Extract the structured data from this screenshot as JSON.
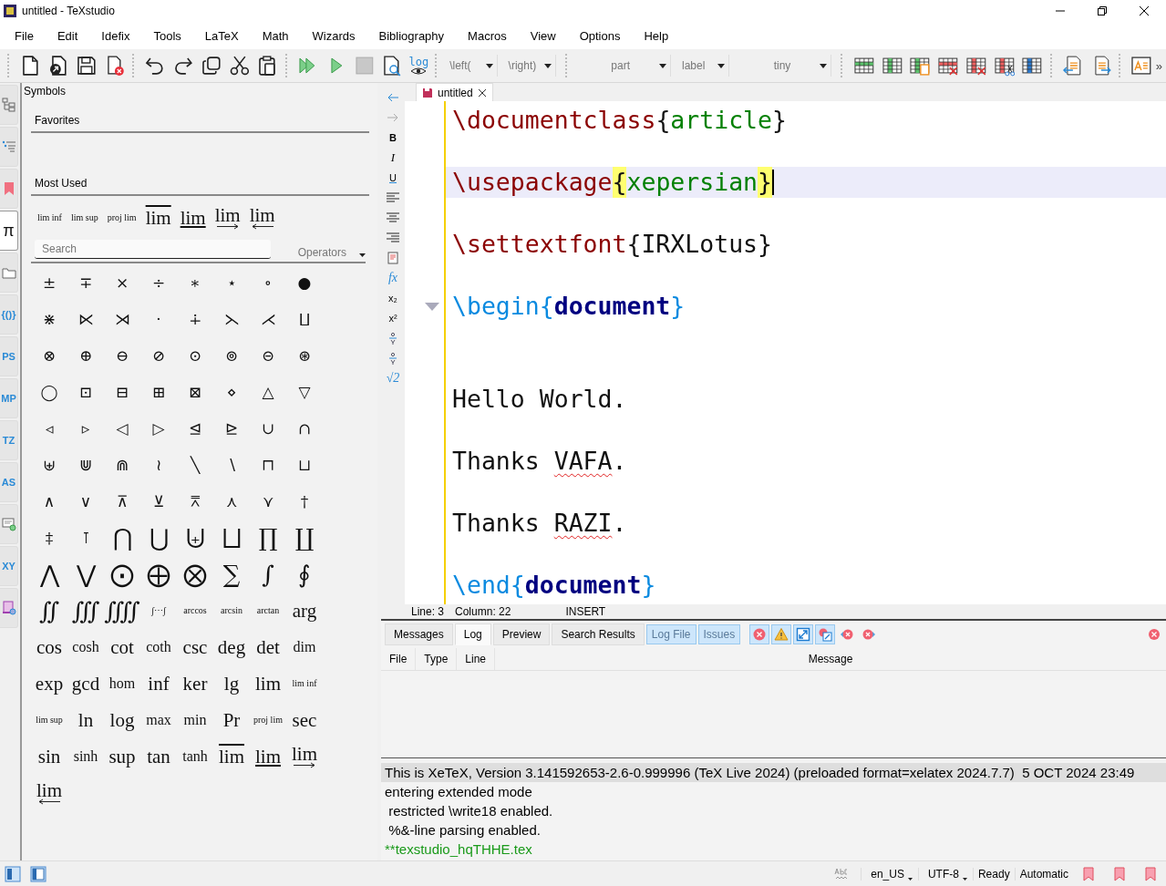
{
  "window": {
    "title": "untitled - TeXstudio"
  },
  "menu": [
    "File",
    "Edit",
    "Idefix",
    "Tools",
    "LaTeX",
    "Math",
    "Wizards",
    "Bibliography",
    "Macros",
    "View",
    "Options",
    "Help"
  ],
  "toolbar": [
    [
      {
        "kind": "new"
      },
      {
        "kind": "open"
      },
      {
        "kind": "save"
      },
      {
        "kind": "close"
      }
    ],
    [
      {
        "kind": "undo"
      },
      {
        "kind": "redo"
      },
      {
        "kind": "copy"
      },
      {
        "kind": "cut"
      },
      {
        "kind": "paste"
      }
    ],
    [
      {
        "kind": "build-view"
      },
      {
        "kind": "compile"
      },
      {
        "kind": "stop"
      },
      {
        "kind": "view"
      },
      {
        "kind": "log",
        "label": "log"
      }
    ],
    [
      {
        "kind": "combo",
        "value": "\\left("
      },
      {
        "kind": "combo",
        "value": "\\right)"
      }
    ],
    [
      {
        "kind": "wide-combo",
        "value": "part"
      },
      {
        "kind": "combo",
        "value": "label"
      },
      {
        "kind": "wide-combo",
        "value": "tiny"
      }
    ],
    [
      {
        "kind": "table-row"
      },
      {
        "kind": "table-column"
      },
      {
        "kind": "table-paste"
      },
      {
        "kind": "table-remove-row"
      },
      {
        "kind": "table-remove-column"
      },
      {
        "kind": "table-cut"
      },
      {
        "kind": "table-align"
      }
    ],
    [
      {
        "kind": "unindent"
      },
      {
        "kind": "indent"
      }
    ],
    [
      {
        "kind": "text-box"
      }
    ]
  ],
  "toolbar_overflow": "»",
  "side_tabs": [
    {
      "kind": "structure",
      "selected": false
    },
    {
      "kind": "todo",
      "selected": false
    },
    {
      "kind": "bookmark",
      "selected": false
    },
    {
      "kind": "text",
      "label": "π",
      "selected": true
    },
    {
      "kind": "files",
      "selected": false
    },
    {
      "kind": "text",
      "label": "{()}",
      "selected": false
    },
    {
      "kind": "text",
      "label": "PS",
      "selected": false
    },
    {
      "kind": "text",
      "label": "MP",
      "selected": false
    },
    {
      "kind": "text",
      "label": "TZ",
      "selected": false
    },
    {
      "kind": "text",
      "label": "AS",
      "selected": false
    },
    {
      "kind": "screen",
      "selected": false
    },
    {
      "kind": "text",
      "label": "XY",
      "selected": false
    },
    {
      "kind": "script",
      "selected": false
    }
  ],
  "symbols_panel": {
    "title": "Symbols",
    "favorites_heading": "Favorites",
    "most_used_heading": "Most Used",
    "most_used": [
      {
        "text": "lim inf",
        "kind": "tiny"
      },
      {
        "text": "lim sup",
        "kind": "tiny"
      },
      {
        "text": "proj lim",
        "kind": "tiny"
      },
      {
        "text": "lim",
        "kind": "overline"
      },
      {
        "text": "lim",
        "kind": "underline"
      },
      {
        "text": "lim",
        "kind": "right-arrow"
      },
      {
        "text": "lim",
        "kind": "left-arrow"
      }
    ],
    "search": {
      "placeholder": "Search"
    },
    "category": "Operators",
    "symbols": [
      {
        "text": "±",
        "kind": "glyph"
      },
      {
        "text": "∓",
        "kind": "glyph"
      },
      {
        "text": "×",
        "kind": "glyph"
      },
      {
        "text": "÷",
        "kind": "glyph"
      },
      {
        "text": "∗",
        "kind": "glyph"
      },
      {
        "text": "⋆",
        "kind": "glyph"
      },
      {
        "text": "∘",
        "kind": "glyph"
      },
      {
        "text": "●",
        "kind": "glyph"
      },
      {
        "text": "⋇",
        "kind": "glyph"
      },
      {
        "text": "⋉",
        "kind": "glyph"
      },
      {
        "text": "⋊",
        "kind": "glyph"
      },
      {
        "text": "·",
        "kind": "glyph"
      },
      {
        "text": "∔",
        "kind": "glyph"
      },
      {
        "text": "⋋",
        "kind": "glyph"
      },
      {
        "text": "⋌",
        "kind": "glyph"
      },
      {
        "text": "⨿",
        "kind": "glyph"
      },
      {
        "text": "⊗",
        "kind": "glyph"
      },
      {
        "text": "⊕",
        "kind": "glyph"
      },
      {
        "text": "⊖",
        "kind": "glyph"
      },
      {
        "text": "⊘",
        "kind": "glyph"
      },
      {
        "text": "⊙",
        "kind": "glyph"
      },
      {
        "text": "⊚",
        "kind": "glyph"
      },
      {
        "text": "⊝",
        "kind": "glyph"
      },
      {
        "text": "⊛",
        "kind": "glyph"
      },
      {
        "text": "◯",
        "kind": "glyph"
      },
      {
        "text": "⊡",
        "kind": "glyph"
      },
      {
        "text": "⊟",
        "kind": "glyph"
      },
      {
        "text": "⊞",
        "kind": "glyph"
      },
      {
        "text": "⊠",
        "kind": "glyph"
      },
      {
        "text": "⋄",
        "kind": "glyph"
      },
      {
        "text": "△",
        "kind": "glyph"
      },
      {
        "text": "▽",
        "kind": "glyph"
      },
      {
        "text": "◃",
        "kind": "glyph"
      },
      {
        "text": "▹",
        "kind": "glyph"
      },
      {
        "text": "◁",
        "kind": "glyph"
      },
      {
        "text": "▷",
        "kind": "glyph"
      },
      {
        "text": "⊴",
        "kind": "glyph"
      },
      {
        "text": "⊵",
        "kind": "glyph"
      },
      {
        "text": "∪",
        "kind": "glyph"
      },
      {
        "text": "∩",
        "kind": "glyph"
      },
      {
        "text": "⊎",
        "kind": "glyph"
      },
      {
        "text": "⋓",
        "kind": "glyph"
      },
      {
        "text": "⋒",
        "kind": "glyph"
      },
      {
        "text": "≀",
        "kind": "glyph"
      },
      {
        "text": "╲",
        "kind": "glyph"
      },
      {
        "text": "∖",
        "kind": "glyph"
      },
      {
        "text": "⊓",
        "kind": "glyph"
      },
      {
        "text": "⊔",
        "kind": "glyph"
      },
      {
        "text": "∧",
        "kind": "glyph"
      },
      {
        "text": "∨",
        "kind": "glyph"
      },
      {
        "text": "⊼",
        "kind": "glyph"
      },
      {
        "text": "⊻",
        "kind": "glyph"
      },
      {
        "text": "⩞",
        "kind": "glyph"
      },
      {
        "text": "⋏",
        "kind": "glyph"
      },
      {
        "text": "⋎",
        "kind": "glyph"
      },
      {
        "text": "†",
        "kind": "glyph"
      },
      {
        "text": "‡",
        "kind": "glyph"
      },
      {
        "text": "⊺",
        "kind": "glyph"
      },
      {
        "text": "⋂",
        "kind": "big"
      },
      {
        "text": "⋃",
        "kind": "big"
      },
      {
        "text": "⨄",
        "kind": "big"
      },
      {
        "text": "⨆",
        "kind": "big"
      },
      {
        "text": "∏",
        "kind": "big"
      },
      {
        "text": "∐",
        "kind": "big"
      },
      {
        "text": "⋀",
        "kind": "big"
      },
      {
        "text": "⋁",
        "kind": "big"
      },
      {
        "text": "⨀",
        "kind": "big"
      },
      {
        "text": "⨁",
        "kind": "big"
      },
      {
        "text": "⨂",
        "kind": "big"
      },
      {
        "text": "∑",
        "kind": "big"
      },
      {
        "text": "∫",
        "kind": "big"
      },
      {
        "text": "∮",
        "kind": "big"
      },
      {
        "text": "∬",
        "kind": "big"
      },
      {
        "text": "∭",
        "kind": "big"
      },
      {
        "text": "⨌",
        "kind": "big"
      },
      {
        "text": "∫⋯∫",
        "kind": "tiny"
      },
      {
        "text": "arccos",
        "kind": "tiny"
      },
      {
        "text": "arcsin",
        "kind": "tiny"
      },
      {
        "text": "arctan",
        "kind": "tiny"
      },
      {
        "text": "arg",
        "kind": "word"
      },
      {
        "text": "cos",
        "kind": "word"
      },
      {
        "text": "cosh",
        "kind": "small"
      },
      {
        "text": "cot",
        "kind": "word"
      },
      {
        "text": "coth",
        "kind": "small"
      },
      {
        "text": "csc",
        "kind": "word"
      },
      {
        "text": "deg",
        "kind": "word"
      },
      {
        "text": "det",
        "kind": "word"
      },
      {
        "text": "dim",
        "kind": "small"
      },
      {
        "text": "exp",
        "kind": "word"
      },
      {
        "text": "gcd",
        "kind": "word"
      },
      {
        "text": "hom",
        "kind": "small"
      },
      {
        "text": "inf",
        "kind": "word"
      },
      {
        "text": "ker",
        "kind": "word"
      },
      {
        "text": "lg",
        "kind": "word"
      },
      {
        "text": "lim",
        "kind": "word"
      },
      {
        "text": "lim inf",
        "kind": "tiny"
      },
      {
        "text": "lim sup",
        "kind": "tiny"
      },
      {
        "text": "ln",
        "kind": "word"
      },
      {
        "text": "log",
        "kind": "word"
      },
      {
        "text": "max",
        "kind": "small"
      },
      {
        "text": "min",
        "kind": "small"
      },
      {
        "text": "Pr",
        "kind": "word"
      },
      {
        "text": "proj lim",
        "kind": "tiny"
      },
      {
        "text": "sec",
        "kind": "word"
      },
      {
        "text": "sin",
        "kind": "word"
      },
      {
        "text": "sinh",
        "kind": "small"
      },
      {
        "text": "sup",
        "kind": "word"
      },
      {
        "text": "tan",
        "kind": "word"
      },
      {
        "text": "tanh",
        "kind": "small"
      },
      {
        "text": "lim",
        "kind": "overline"
      },
      {
        "text": "lim",
        "kind": "underline"
      },
      {
        "text": "lim",
        "kind": "right-arrow"
      },
      {
        "text": "lim",
        "kind": "left-arrow"
      }
    ]
  },
  "format_bar": [
    {
      "kind": "back"
    },
    {
      "kind": "forward"
    },
    {
      "kind": "bold",
      "label": "B"
    },
    {
      "kind": "italic",
      "label": "I"
    },
    {
      "kind": "underline",
      "label": "U"
    },
    {
      "kind": "align-left"
    },
    {
      "kind": "align-center"
    },
    {
      "kind": "align-right"
    },
    {
      "kind": "document"
    },
    {
      "kind": "function",
      "label": "fx"
    },
    {
      "kind": "subscript",
      "label": "x₂"
    },
    {
      "kind": "superscript",
      "label": "x²"
    },
    {
      "kind": "fraction"
    },
    {
      "kind": "fraction"
    },
    {
      "kind": "root",
      "label": "√2"
    }
  ],
  "editor": {
    "tab": {
      "title": "untitled"
    },
    "lines": [
      {
        "current": false,
        "foldable": false,
        "segments": [
          {
            "text": "\\documentclass",
            "kind": "command"
          },
          {
            "text": "{",
            "kind": "brace"
          },
          {
            "text": "article",
            "kind": "arg"
          },
          {
            "text": "}",
            "kind": "brace"
          }
        ]
      },
      {
        "current": false,
        "foldable": false
      },
      {
        "current": true,
        "foldable": false,
        "segments": [
          {
            "text": "\\usepackage",
            "kind": "command"
          },
          {
            "text": "{",
            "kind": "matched-brace"
          },
          {
            "text": "xepersian",
            "kind": "arg"
          },
          {
            "text": "}",
            "kind": "matched-brace"
          }
        ]
      },
      {
        "current": false,
        "foldable": false
      },
      {
        "current": false,
        "foldable": false,
        "segments": [
          {
            "text": "\\settextfont",
            "kind": "command"
          },
          {
            "text": "{IRXLotus}",
            "kind": "brace"
          }
        ]
      },
      {
        "current": false,
        "foldable": false
      },
      {
        "current": false,
        "foldable": true,
        "segments": [
          {
            "text": "\\begin{",
            "kind": "environment"
          },
          {
            "text": "document",
            "kind": "environment-name"
          },
          {
            "text": "}",
            "kind": "environment"
          }
        ]
      },
      {
        "current": false,
        "foldable": false
      },
      {
        "current": false,
        "foldable": false
      },
      {
        "current": false,
        "foldable": false,
        "segments": [
          {
            "text": "Hello World.",
            "kind": "text"
          }
        ]
      },
      {
        "current": false,
        "foldable": false
      },
      {
        "current": false,
        "foldable": false,
        "segments": [
          {
            "text": "Thanks ",
            "kind": "text"
          },
          {
            "text": "VAFA",
            "kind": "misspelled"
          },
          {
            "text": ".",
            "kind": "text"
          }
        ]
      },
      {
        "current": false,
        "foldable": false
      },
      {
        "current": false,
        "foldable": false,
        "segments": [
          {
            "text": "Thanks ",
            "kind": "text"
          },
          {
            "text": "RAZI",
            "kind": "misspelled"
          },
          {
            "text": ".",
            "kind": "text"
          }
        ]
      },
      {
        "current": false,
        "foldable": false
      },
      {
        "current": false,
        "foldable": false,
        "segments": [
          {
            "text": "\\end{",
            "kind": "environment"
          },
          {
            "text": "document",
            "kind": "environment-name"
          },
          {
            "text": "}",
            "kind": "environment"
          }
        ]
      }
    ],
    "position": {
      "line": "Line: 3",
      "column": "Column: 22",
      "mode": "INSERT"
    }
  },
  "messages": {
    "tabs": [
      {
        "label": "Messages",
        "selected": false
      },
      {
        "label": "Log",
        "selected": true
      },
      {
        "label": "Preview",
        "selected": false
      },
      {
        "label": "Search Results",
        "selected": false
      }
    ],
    "toggles": [
      {
        "label": "Log File",
        "on": true
      },
      {
        "label": "Issues",
        "on": true
      }
    ],
    "filters": [
      {
        "kind": "error",
        "on": true
      },
      {
        "kind": "warning",
        "on": true
      },
      {
        "kind": "badbox",
        "on": true
      },
      {
        "kind": "log-marker",
        "on": true
      },
      {
        "kind": "previous-error",
        "on": false
      },
      {
        "kind": "next-error",
        "on": false
      }
    ],
    "columns": [
      "File",
      "Type",
      "Line",
      "Message"
    ],
    "log": [
      {
        "text": "This is XeTeX, Version 3.141592653-2.6-0.999996 (TeX Live 2024) (preloaded format=xelatex 2024.7.7)  5 OCT 2024 23:49",
        "kind": "normal",
        "selected": true
      },
      {
        "text": "entering extended mode",
        "kind": "normal",
        "selected": false
      },
      {
        "text": " restricted \\write18 enabled.",
        "kind": "normal",
        "selected": false
      },
      {
        "text": " %&-line parsing enabled.",
        "kind": "normal",
        "selected": false
      },
      {
        "text": "**texstudio_hqTHHE.tex",
        "kind": "file",
        "selected": false
      }
    ]
  },
  "status_bar": {
    "language": "en_US",
    "encoding": "UTF-8",
    "state": "Ready",
    "mode": "Automatic",
    "bookmarks": [
      {
        "kind": "bookmark"
      },
      {
        "kind": "bookmark"
      },
      {
        "kind": "bookmark"
      }
    ]
  }
}
